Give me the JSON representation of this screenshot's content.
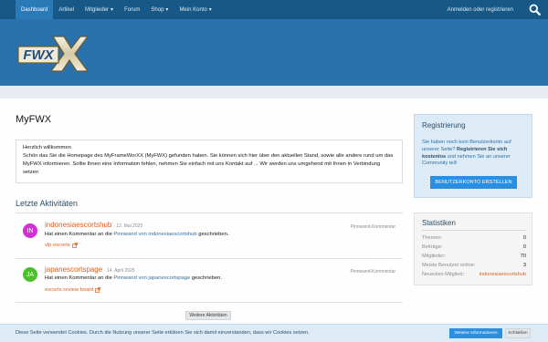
{
  "nav": {
    "tabs": [
      {
        "label": "Dashboard"
      },
      {
        "label": "Artikel"
      },
      {
        "label": "Mitglieder",
        "chevron": "▾"
      },
      {
        "label": "Forum"
      },
      {
        "label": "Shop",
        "chevron": "▾"
      },
      {
        "label": "Mein Konto",
        "chevron": "▾"
      }
    ],
    "login": "Anmelden oder registrieren",
    "search_icon": "search-icon"
  },
  "banner": {
    "logo_text": "FWX"
  },
  "page": {
    "title": "MyFWX",
    "welcome_heading": "Herzlich willkommen",
    "welcome_body": "Schön das Sie die Homepage des MyFrameWorXX (MyFWX) gefunden haben. Sie können sich hier über den aktuellen Stand, sowie alle andere rund um das MyFWX informieren. Sollte Ihnen eine Information fehlen, nehmen Sie einfach mit uns Kontakt auf ... Wir werden uns umgehend mit Ihnen in Verbindung setzen"
  },
  "activities": {
    "title": "Letzte Aktivitäten",
    "items": [
      {
        "avatar": "IN",
        "avatar_color": "#d22fd6",
        "user": "indonesiaescortshub",
        "date": "· 12. Mai 2025",
        "type": "Pinnwand-Kommentar",
        "text_before": "Hat einen Kommentar an die ",
        "link": "Pinnwand von indonesiaescortshub",
        "text_after": " geschrieben.",
        "extra": "vip escorts"
      },
      {
        "avatar": "JA",
        "avatar_color": "#4cbf2d",
        "user": "japanescortspage",
        "date": "· 14. April 2025",
        "type": "Pinnwand-Kommentar",
        "text_before": "Hat einen Kommentar an die ",
        "link": "Pinnwand von japanescortspage",
        "text_after": " geschrieben.",
        "extra": "escorts review board"
      }
    ],
    "more_label": "Weitere Aktivitäten"
  },
  "sidebar": {
    "registration": {
      "title": "Registrierung",
      "text_1": "Sie haben noch kein Benutzerkonto auf unserer Seite? ",
      "text_bold": "Registrieren Sie sich kostenlos",
      "text_2": " und nehmen Sie an unserer Community teil!",
      "button": "BENUTZERKONTO ERSTELLEN"
    },
    "stats": {
      "title": "Statistiken",
      "rows": [
        {
          "label": "Themen:",
          "value": "0"
        },
        {
          "label": "Beiträge:",
          "value": "0"
        },
        {
          "label": "Mitglieder:",
          "value": "70"
        },
        {
          "label": "Meiste Benutzer online:",
          "value": "3"
        },
        {
          "label": "Neuestes Mitglied:",
          "value": "indonesiaescortshub"
        }
      ]
    }
  },
  "cookie": {
    "message": "Diese Seite verwendet Cookies. Durch die Nutzung unserer Seite erklären Sie sich damit einverstanden, dass wir Cookies setzen.",
    "more": "Weitere Informationen",
    "close": "Schließen"
  },
  "colors": {
    "nav": "#185886",
    "banner": "#2a72ad",
    "accent_link": "#e05e1b",
    "button": "#2a8fe0"
  }
}
